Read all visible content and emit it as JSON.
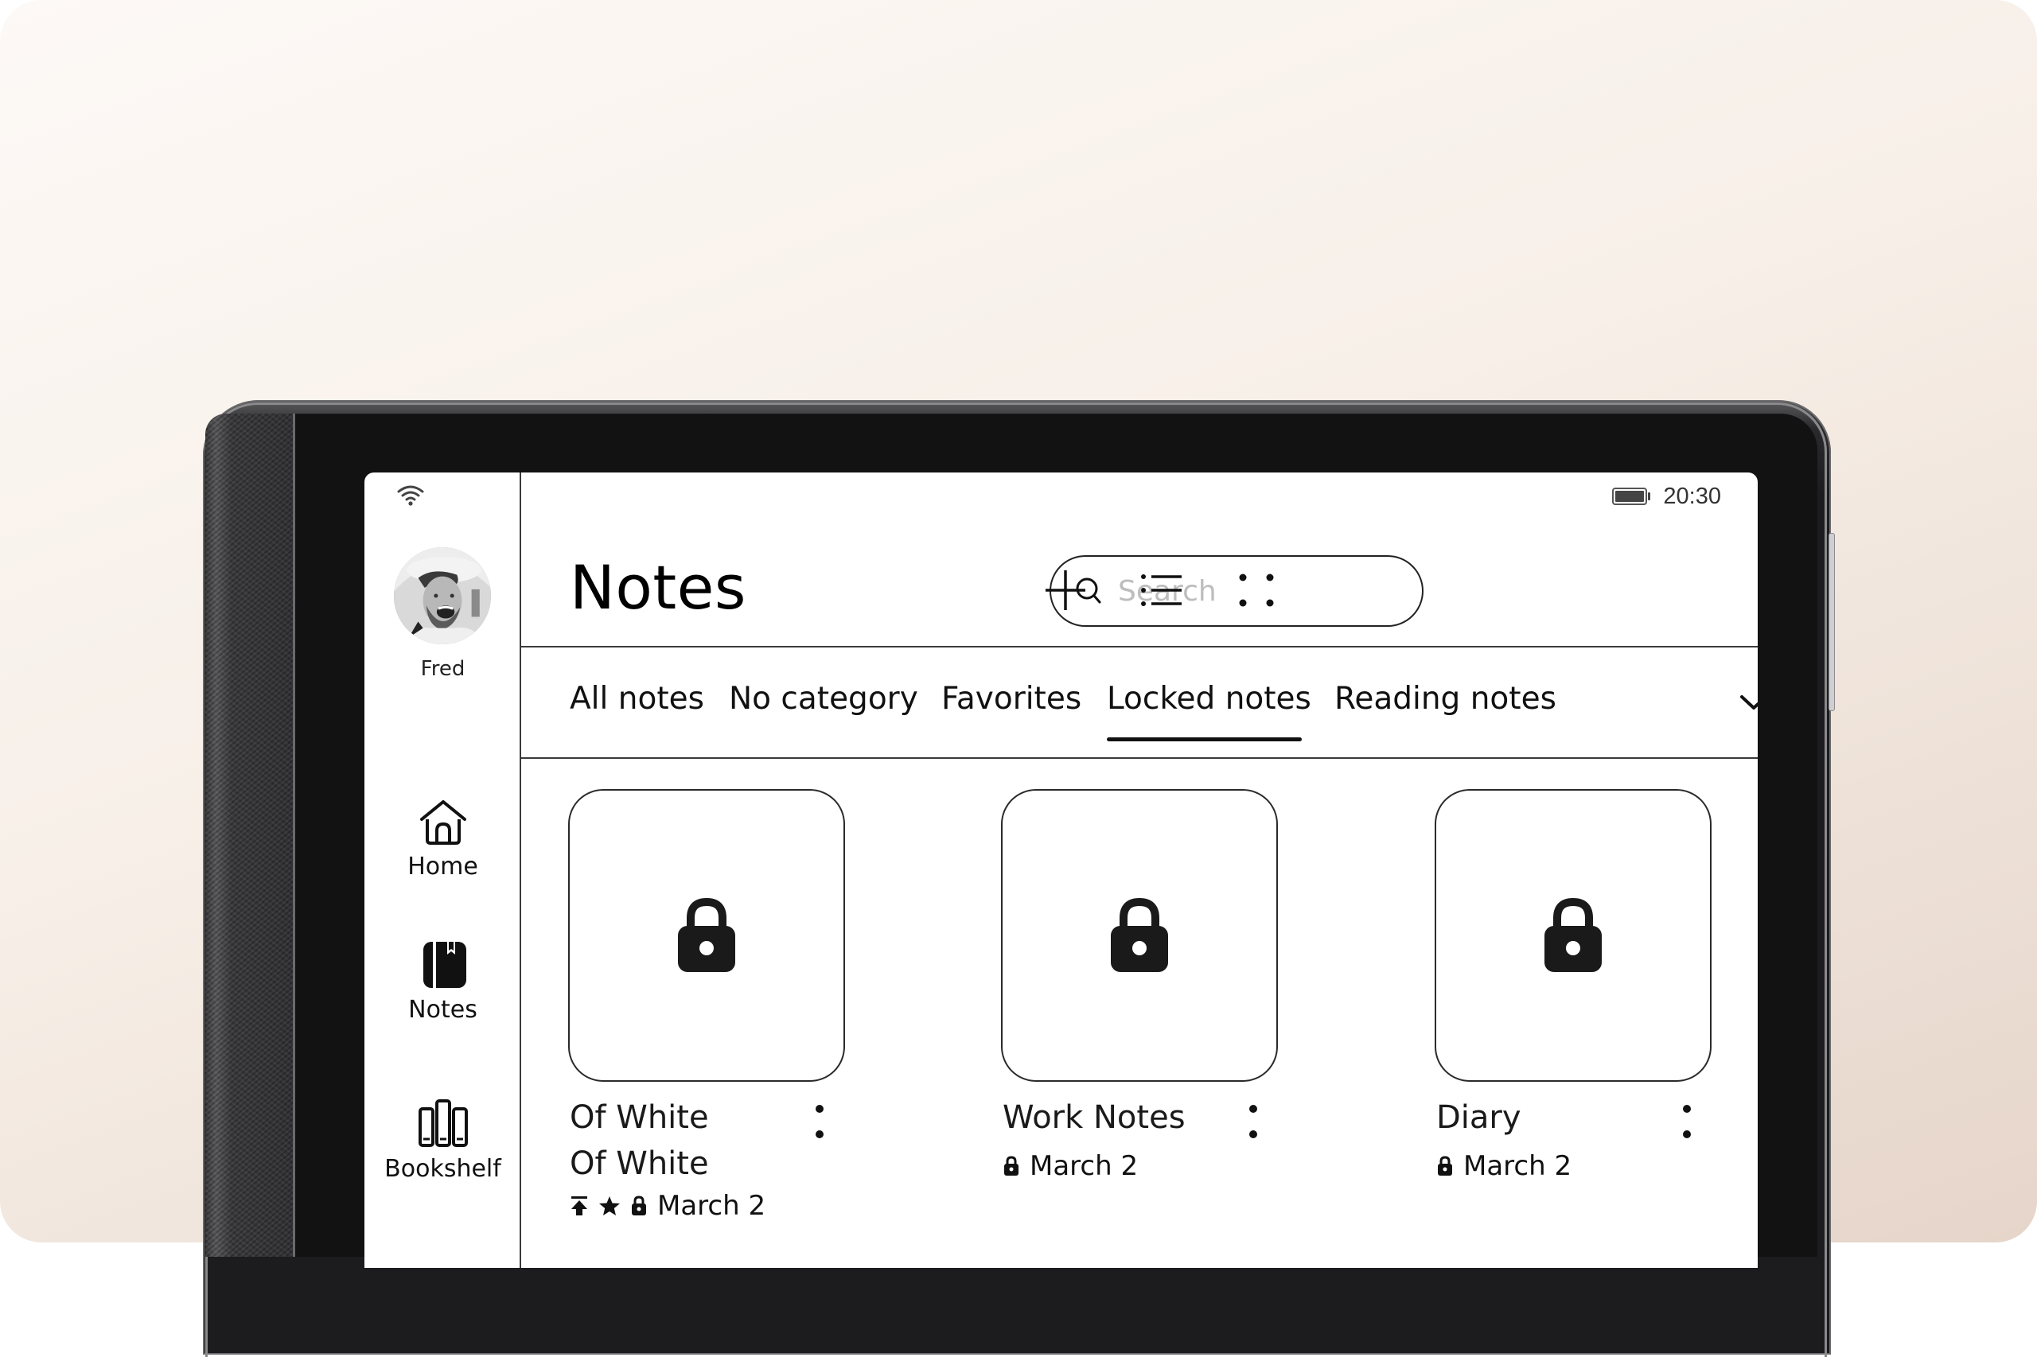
{
  "status_bar": {
    "wifi_icon": "wifi-icon",
    "battery_icon": "battery-full-icon",
    "time": "20:30"
  },
  "sidebar": {
    "user": {
      "name": "Fred",
      "avatar": "avatar-photo"
    },
    "items": [
      {
        "label": "Home",
        "icon": "home-icon"
      },
      {
        "label": "Notes",
        "icon": "notebook-icon",
        "active": true
      },
      {
        "label": "Bookshelf",
        "icon": "bookshelf-icon"
      }
    ]
  },
  "header": {
    "title": "Notes",
    "search": {
      "placeholder": "Search",
      "value": ""
    },
    "actions": [
      {
        "name": "add",
        "icon": "plus-icon"
      },
      {
        "name": "list-view",
        "icon": "list-icon"
      },
      {
        "name": "more",
        "icon": "four-dots-icon"
      }
    ]
  },
  "tabs": {
    "items": [
      {
        "label": "All notes"
      },
      {
        "label": "No category"
      },
      {
        "label": "Favorites"
      },
      {
        "label": "Locked notes",
        "active": true
      },
      {
        "label": "Reading notes"
      }
    ],
    "expand_icon": "chevron-down-icon"
  },
  "notes": [
    {
      "title_line1": "Of White",
      "title_line2": "Of White",
      "date": "March 2",
      "flags": [
        "pinned",
        "favorite",
        "locked"
      ]
    },
    {
      "title_line1": "Work Notes",
      "date": "March 2",
      "flags": [
        "locked"
      ]
    },
    {
      "title_line1": "Diary",
      "date": "March 2",
      "flags": [
        "locked"
      ]
    }
  ],
  "colors": {
    "ink": "#111111",
    "placeholder": "#bdbdbd",
    "bezel": "#121213",
    "background_top": "#fdf9f6",
    "background_bottom": "#e6d5ca"
  }
}
